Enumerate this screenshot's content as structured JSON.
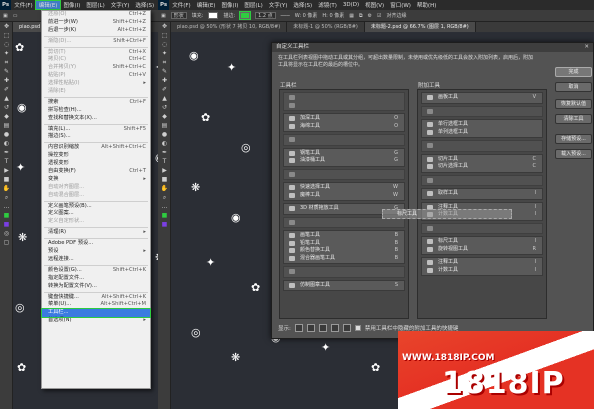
{
  "app": {
    "logo": "Ps"
  },
  "menubar": {
    "items": [
      "文件(F)",
      "编辑(E)",
      "图像(I)",
      "图层(L)",
      "文字(Y)",
      "选择(S)",
      "Ps"
    ],
    "items_right": [
      "文件(F)",
      "编辑(E)",
      "图像(I)",
      "图层(L)",
      "文字(Y)",
      "选择(S)",
      "滤镜(T)",
      "3D(D)",
      "视图(V)",
      "窗口(W)",
      "帮助(H)"
    ]
  },
  "optionbar": {
    "opacity_label": "不透明度:",
    "size": "1.2 点",
    "feather": "0 像素",
    "antialias_label": "对齐边缘"
  },
  "tabs": [
    "piao.psd",
    "piao.psd @ 50% (形状 7 拷贝 10, RGB/8#)",
    "未标题-1 @ 50% (RGB/8#)",
    "未标题-2.psd @ 66.7% (图层 1, RGB/8#)"
  ],
  "edit_menu": {
    "items": [
      {
        "label": "还原(O)",
        "shortcut": "Ctrl+Z",
        "disabled": true
      },
      {
        "label": "前进一步(W)",
        "shortcut": "Shift+Ctrl+Z",
        "disabled": false
      },
      {
        "label": "后退一步(K)",
        "shortcut": "Alt+Ctrl+Z",
        "disabled": false
      },
      {
        "sep": true
      },
      {
        "label": "渐隐(D)...",
        "shortcut": "Shift+Ctrl+F",
        "disabled": true
      },
      {
        "sep": true
      },
      {
        "label": "剪切(T)",
        "shortcut": "Ctrl+X",
        "disabled": true
      },
      {
        "label": "拷贝(C)",
        "shortcut": "Ctrl+C",
        "disabled": true
      },
      {
        "label": "合并拷贝(Y)",
        "shortcut": "Shift+Ctrl+C",
        "disabled": true
      },
      {
        "label": "粘贴(P)",
        "shortcut": "Ctrl+V",
        "disabled": true
      },
      {
        "label": "选择性粘贴(I)",
        "shortcut": "▸",
        "disabled": true
      },
      {
        "label": "清除(E)",
        "shortcut": "",
        "disabled": true
      },
      {
        "sep": true
      },
      {
        "label": "搜索",
        "shortcut": "Ctrl+F",
        "disabled": false
      },
      {
        "label": "拼写检查(H)...",
        "shortcut": "",
        "disabled": false
      },
      {
        "label": "查找和替换文本(X)...",
        "shortcut": "",
        "disabled": false
      },
      {
        "sep": true
      },
      {
        "label": "填充(L)...",
        "shortcut": "Shift+F5",
        "disabled": false
      },
      {
        "label": "描边(S)...",
        "shortcut": "",
        "disabled": false
      },
      {
        "sep": true
      },
      {
        "label": "内容识别缩放",
        "shortcut": "Alt+Shift+Ctrl+C",
        "disabled": false
      },
      {
        "label": "操控变形",
        "shortcut": "",
        "disabled": false
      },
      {
        "label": "透视变形",
        "shortcut": "",
        "disabled": false
      },
      {
        "label": "自由变换(F)",
        "shortcut": "Ctrl+T",
        "disabled": false
      },
      {
        "label": "变换",
        "shortcut": "▸",
        "disabled": false
      },
      {
        "label": "自动对齐图层...",
        "shortcut": "",
        "disabled": true
      },
      {
        "label": "自动混合图层...",
        "shortcut": "",
        "disabled": true
      },
      {
        "sep": true
      },
      {
        "label": "定义画笔预设(B)...",
        "shortcut": "",
        "disabled": false
      },
      {
        "label": "定义图案...",
        "shortcut": "",
        "disabled": false
      },
      {
        "label": "定义自定形状...",
        "shortcut": "",
        "disabled": true
      },
      {
        "sep": true
      },
      {
        "label": "清理(R)",
        "shortcut": "▸",
        "disabled": false
      },
      {
        "sep": true
      },
      {
        "label": "Adobe PDF 预设...",
        "shortcut": "",
        "disabled": false
      },
      {
        "label": "预设",
        "shortcut": "▸",
        "disabled": false
      },
      {
        "label": "远程连接...",
        "shortcut": "",
        "disabled": false
      },
      {
        "sep": true
      },
      {
        "label": "颜色设置(G)...",
        "shortcut": "Shift+Ctrl+K",
        "disabled": false
      },
      {
        "label": "指定配置文件...",
        "shortcut": "",
        "disabled": false
      },
      {
        "label": "转换为配置文件(V)...",
        "shortcut": "",
        "disabled": false
      },
      {
        "sep": true
      },
      {
        "label": "键盘快捷键...",
        "shortcut": "Alt+Shift+Ctrl+K",
        "disabled": false
      },
      {
        "label": "菜单(U)...",
        "shortcut": "Alt+Shift+Ctrl+M",
        "disabled": false
      },
      {
        "label": "工具栏...",
        "shortcut": "",
        "disabled": false,
        "selected": true
      },
      {
        "label": "首选项(N)",
        "shortcut": "▸",
        "disabled": false
      }
    ]
  },
  "dialog": {
    "title": "自定义工具栏",
    "close": "✕",
    "description": "在工具栏列表视图中拖动工具或其分组，可超出数量限制，未使用或优先级低的工具会放入附加列表，启用后，附加工具将显示在工具栏的最后的槽位中。",
    "col_left": "工具栏",
    "col_right": "附加工具",
    "buttons": [
      "完成",
      "取消",
      "恢复默认值",
      "清除工具",
      "存储预设...",
      "载入预设..."
    ],
    "left_groups": [
      {
        "items": [
          {
            "name": "",
            "key": ""
          },
          {
            "name": "",
            "key": ""
          }
        ]
      },
      {
        "items": [
          {
            "name": "加深工具",
            "key": "O"
          },
          {
            "name": "海绵工具",
            "key": "O"
          }
        ]
      },
      {
        "items": [
          {
            "name": "",
            "key": ""
          }
        ]
      },
      {
        "items": [
          {
            "name": "钢笔工具",
            "key": "G"
          },
          {
            "name": "油漆桶工具",
            "key": "G"
          }
        ]
      },
      {
        "items": [
          {
            "name": "",
            "key": ""
          }
        ]
      },
      {
        "items": [
          {
            "name": "快速选择工具",
            "key": "W"
          },
          {
            "name": "魔棒工具",
            "key": "W"
          }
        ]
      },
      {
        "items": [
          {
            "name": "3D 材质拖放工具",
            "key": "G"
          }
        ]
      },
      {
        "items": [
          {
            "name": "",
            "key": ""
          }
        ]
      },
      {
        "items": [
          {
            "name": "画笔工具",
            "key": "B"
          },
          {
            "name": "铅笔工具",
            "key": "B"
          },
          {
            "name": "颜色替换工具",
            "key": "B"
          },
          {
            "name": "混合器画笔工具",
            "key": "B"
          }
        ]
      },
      {
        "items": [
          {
            "name": "",
            "key": ""
          }
        ]
      },
      {
        "items": [
          {
            "name": "仿制图章工具",
            "key": "S"
          }
        ]
      }
    ],
    "right_groups": [
      {
        "items": [
          {
            "name": "画板工具",
            "key": "V"
          }
        ]
      },
      {
        "items": [
          {
            "name": "",
            "key": ""
          }
        ]
      },
      {
        "items": [
          {
            "name": "单行选框工具",
            "key": ""
          },
          {
            "name": "单列选框工具",
            "key": ""
          }
        ]
      },
      {
        "items": [
          {
            "name": "",
            "key": ""
          }
        ]
      },
      {
        "items": [
          {
            "name": "切片工具",
            "key": "C"
          },
          {
            "name": "切片选择工具",
            "key": "C"
          }
        ]
      },
      {
        "items": [
          {
            "name": "",
            "key": ""
          }
        ]
      },
      {
        "items": [
          {
            "name": "取样工具",
            "key": "I"
          }
        ]
      },
      {
        "items": [
          {
            "name": "注释工具",
            "key": "I"
          },
          {
            "name": "计数工具",
            "key": "I"
          }
        ]
      },
      {
        "items": [
          {
            "name": "",
            "key": ""
          }
        ]
      },
      {
        "items": [
          {
            "name": "标尺工具",
            "key": "I"
          },
          {
            "name": "旋转视图工具",
            "key": "R"
          }
        ]
      },
      {
        "items": [
          {
            "name": "注释工具",
            "key": "I"
          },
          {
            "name": "计数工具",
            "key": "I"
          }
        ]
      }
    ],
    "drag_ghost": "标尺工具",
    "bottom_label": "显示:",
    "checkbox_label": "禁用工具栏中隐藏的附加工具的快捷键"
  },
  "watermark": {
    "url": "WWW.1818IP.COM",
    "brand": "1818IP"
  },
  "colors": {
    "menu_highlight": "#3b7be0",
    "annotation_green": "#2ecc40",
    "watermark_red": "#e53224"
  }
}
